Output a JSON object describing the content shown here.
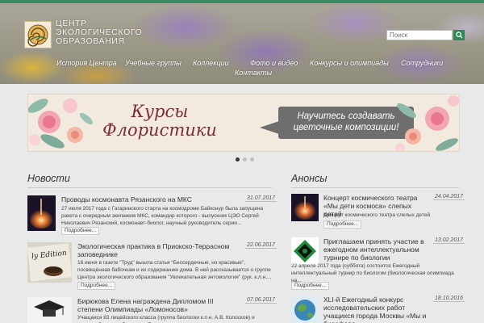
{
  "header": {
    "logo_text": "Центр экологического образования",
    "search_placeholder": "Поиск"
  },
  "nav": {
    "items": [
      {
        "label": "История Центра"
      },
      {
        "label": "Учебные группы"
      },
      {
        "label": "Коллекции"
      },
      {
        "label": "Фото и видео"
      },
      {
        "label": "Конкурсы и олимпиады"
      },
      {
        "label": "Сотрудники"
      },
      {
        "label": "Контакты"
      }
    ]
  },
  "banner": {
    "title": "Курсы Флористики",
    "bubble_text": "Научитесь создавать цветочные композиции!",
    "slides": 3,
    "active_slide": 1
  },
  "news": {
    "title": "Новости",
    "items": [
      {
        "title": "Проводы космонавта Рязанского на МКС",
        "date": "31.07.2017",
        "body": "27 июля 2017 года с Гагаринского старта на космодроме Байконур была запущена ракета с очередным экипажем МКС, командир которого - выпускник ЦЭО Сергей Николаевич Рязанский, космонавт-биолог, научный руководитель серии...",
        "more": "Подробнее..."
      },
      {
        "title": "Экологическая практика в Приокско-Террасном заповеднике",
        "date": "22.06.2017",
        "body": "16 июня в газете \"Труд\" вышла статья \"Бессердечные, но красивые\", посвящённая бабочкам и их содержанию дома. В ней рассказывается о группе Центра экологического образования \"Увлекательная энтомология\" (рук. к.л.н....",
        "more": "Подробнее..."
      },
      {
        "title": "Бирюкова Елена награждена Дипломом III степени Олимпиады «Ломоносов»",
        "date": "07.06.2017",
        "body": "Учащаяся 83 лицейского класса (группа биологии к.п.н. А.В. Колосков) и кружков биологии Бирюкова Елена, сдав неоднократно, и на..."
      }
    ]
  },
  "announcements": {
    "title": "Анонсы",
    "items": [
      {
        "title": "Концерт космического театра «Мы дети космоса» слепых детей",
        "date": "24.04.2017",
        "body": "Концерт космического театра слепых детей",
        "more": "Подробнее..."
      },
      {
        "title": "Приглашаем принять участие в ежегодном интеллектуальном турнире по биологии",
        "date": "13.02.2017",
        "body": "22 апреля 2017 года (суббота) состоится Ежегодный интеллектуальный турнир по биологии (биологическая олимпиада на...",
        "more": "Подробнее..."
      },
      {
        "title": "XLI-й Ежегодный конкурс исследовательских работ учащихся города Москвы «Мы и биосфера»",
        "date": "18.10.2016"
      }
    ]
  },
  "colors": {
    "accent": "#3a8c64",
    "search_button": "#2d8a57",
    "banner_title": "#7c2d36",
    "bubble": "#6e6e6e"
  }
}
